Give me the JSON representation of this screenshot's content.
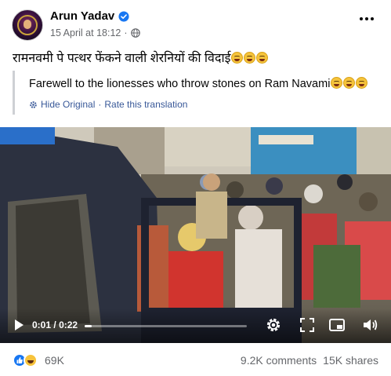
{
  "post": {
    "author": "Arun Yadav",
    "timestamp": "15 April at 18:12",
    "separator": "·",
    "caption": "रामनवमी पे पत्थर फेंकने वाली शेरनियों की विदाई",
    "translation": {
      "text": "Farewell to the lionesses who throw stones on Ram Navami",
      "hide_original": "Hide Original",
      "dot": "·",
      "rate": "Rate this translation"
    }
  },
  "video": {
    "current_time": "0:01",
    "time_separator": "/",
    "duration": "0:22",
    "progress_fraction": 0.045
  },
  "footer": {
    "reaction_count": "69K",
    "comments": "9.2K comments",
    "shares": "15K shares"
  },
  "icons": {
    "verified": "verified-badge-icon",
    "globe": "globe-icon",
    "more": "more-options-icon",
    "play": "play-icon",
    "settings": "settings-gear-icon",
    "pip": "picture-in-picture-icon",
    "volume": "volume-icon",
    "like": "like-reaction-icon",
    "haha": "haha-reaction-icon"
  },
  "colors": {
    "accent": "#1877f2",
    "link": "#385898",
    "muted": "#65676b"
  }
}
